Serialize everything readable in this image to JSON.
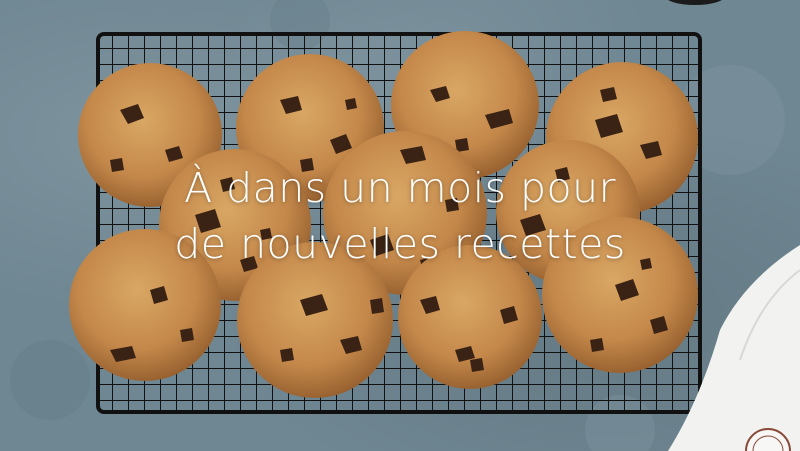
{
  "hero": {
    "caption_line1": "À dans un mois pour",
    "caption_line2": "de nouvelles recettes"
  },
  "colors": {
    "background": "#6f8793",
    "rack": "#111111",
    "cookie": "#c98f4c",
    "chocolate": "#3a2314",
    "caption": "#ffffff"
  },
  "icons": [
    "cooling-rack-icon",
    "cookie-icon",
    "napkin-icon",
    "stamp-logo-icon"
  ]
}
